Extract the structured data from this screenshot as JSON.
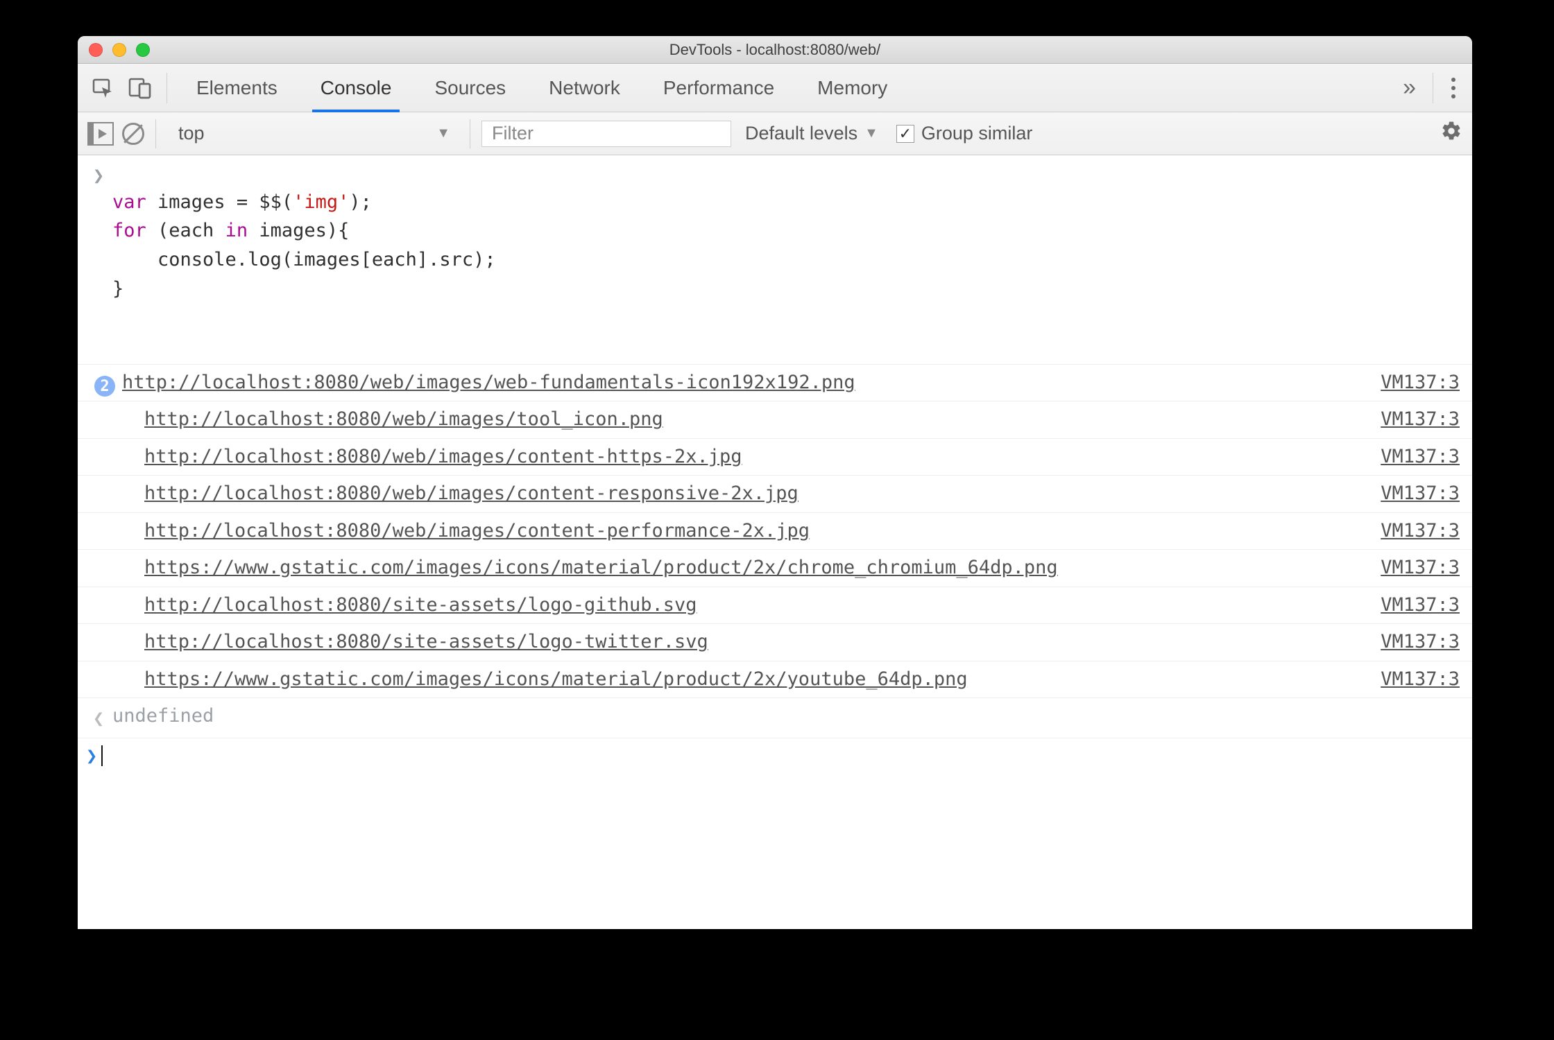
{
  "title": "DevTools - localhost:8080/web/",
  "tabs": {
    "elements": "Elements",
    "console": "Console",
    "sources": "Sources",
    "network": "Network",
    "performance": "Performance",
    "memory": "Memory",
    "more": "»"
  },
  "toolbar": {
    "context": "top",
    "filter_placeholder": "Filter",
    "levels": "Default levels",
    "group_similar": "Group similar",
    "group_checked": "✓"
  },
  "code": {
    "l1a": "var",
    "l1b": " images = $$(",
    "l1c": "'img'",
    "l1d": ");",
    "l2a": "for",
    "l2b": " (each ",
    "l2c": "in",
    "l2d": " images){",
    "l3": "    console.log(images[each].src);",
    "l4": "}"
  },
  "badge_count": "2",
  "logs": [
    {
      "url": "http://localhost:8080/web/images/web-fundamentals-icon192x192.png",
      "src": "VM137:3",
      "badge": true
    },
    {
      "url": "http://localhost:8080/web/images/tool_icon.png",
      "src": "VM137:3"
    },
    {
      "url": "http://localhost:8080/web/images/content-https-2x.jpg",
      "src": "VM137:3"
    },
    {
      "url": "http://localhost:8080/web/images/content-responsive-2x.jpg",
      "src": "VM137:3"
    },
    {
      "url": "http://localhost:8080/web/images/content-performance-2x.jpg",
      "src": "VM137:3"
    },
    {
      "url": "https://www.gstatic.com/images/icons/material/product/2x/chrome_chromium_64dp.png",
      "src": "VM137:3"
    },
    {
      "url": "http://localhost:8080/site-assets/logo-github.svg",
      "src": "VM137:3"
    },
    {
      "url": "http://localhost:8080/site-assets/logo-twitter.svg",
      "src": "VM137:3"
    },
    {
      "url": "https://www.gstatic.com/images/icons/material/product/2x/youtube_64dp.png",
      "src": "VM137:3"
    }
  ],
  "return_value": "undefined"
}
